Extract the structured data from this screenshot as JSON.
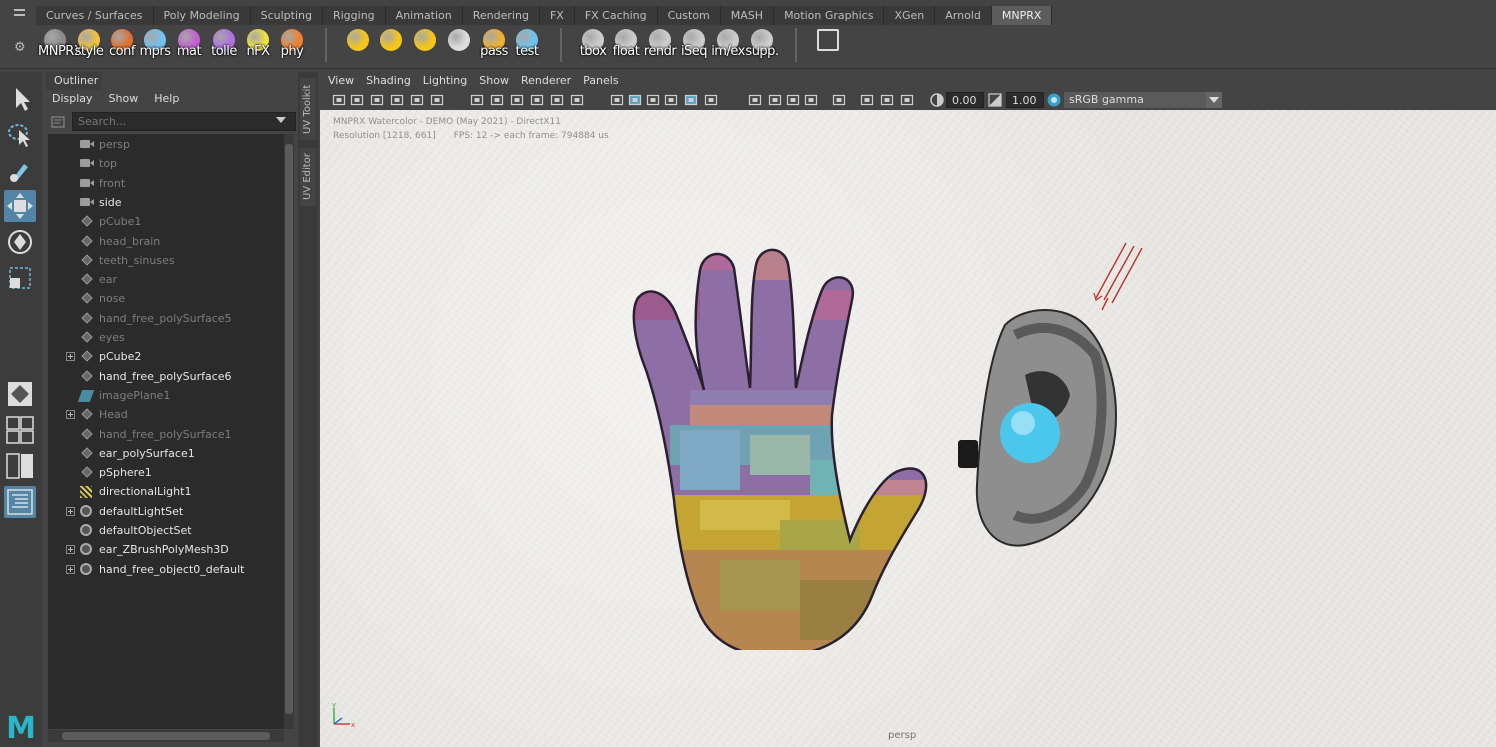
{
  "shelf_tabs": [
    "Curves / Surfaces",
    "Poly Modeling",
    "Sculpting",
    "Rigging",
    "Animation",
    "Rendering",
    "FX",
    "FX Caching",
    "Custom",
    "MASH",
    "Motion Graphics",
    "XGen",
    "Arnold",
    "MNPRX"
  ],
  "active_shelf_tab": "MNPRX",
  "shelf_buttons": [
    {
      "label": "MNPRX",
      "icon": "mnprx-info-icon",
      "color": "#8a8a8a"
    },
    {
      "label": "style",
      "icon": "style-icon",
      "color": "#f0c040"
    },
    {
      "label": "conf",
      "icon": "config-icon",
      "color": "#e07030"
    },
    {
      "label": "mprs",
      "icon": "material-presets-icon",
      "color": "#6fc2ee"
    },
    {
      "label": "mat",
      "icon": "material-icon",
      "color": "#c060d0"
    },
    {
      "label": "tolle",
      "icon": "toolbox-icon",
      "color": "#b070e0"
    },
    {
      "label": "nFX",
      "icon": "noise-fx-icon",
      "color": "#f0e040"
    },
    {
      "label": "phy",
      "icon": "physics-icon",
      "color": "#f08030"
    },
    {
      "label": "",
      "icon": "sun-light-icon",
      "color": "#f5c518"
    },
    {
      "label": "",
      "icon": "light-arrows-icon",
      "color": "#f5c518"
    },
    {
      "label": "",
      "icon": "light-center-icon",
      "color": "#f5c518"
    },
    {
      "label": "",
      "icon": "spot-light-icon",
      "color": "#dddddd"
    },
    {
      "label": "pass",
      "icon": "render-pass-icon",
      "color": "#f0b030"
    },
    {
      "label": "test",
      "icon": "test-scene-icon",
      "color": "#6fc2ee"
    },
    {
      "label": "tbox",
      "icon": "toolbox-window-icon",
      "color": "#cccccc"
    },
    {
      "label": "float",
      "icon": "float-window-icon",
      "color": "#cccccc"
    },
    {
      "label": "rendr",
      "icon": "render-frame-icon",
      "color": "#cccccc"
    },
    {
      "label": "iSeq",
      "icon": "image-sequence-icon",
      "color": "#cccccc"
    },
    {
      "label": "im/ex",
      "icon": "import-export-icon",
      "color": "#cccccc"
    },
    {
      "label": "supp.",
      "icon": "support-icon",
      "color": "#cccccc"
    },
    {
      "label": "",
      "icon": "external-link-icon",
      "color": "#dddddd"
    }
  ],
  "outliner": {
    "tab": "Outliner",
    "menus": [
      "Display",
      "Show",
      "Help"
    ],
    "search_placeholder": "Search...",
    "items": [
      {
        "name": "persp",
        "icon": "camera",
        "dim": true,
        "expand": false
      },
      {
        "name": "top",
        "icon": "camera",
        "dim": true,
        "expand": false
      },
      {
        "name": "front",
        "icon": "camera",
        "dim": true,
        "expand": false
      },
      {
        "name": "side",
        "icon": "camera",
        "dim": false,
        "expand": false
      },
      {
        "name": "pCube1",
        "icon": "mesh",
        "dim": true,
        "expand": false
      },
      {
        "name": "head_brain",
        "icon": "mesh",
        "dim": true,
        "expand": false
      },
      {
        "name": "teeth_sinuses",
        "icon": "mesh",
        "dim": true,
        "expand": false
      },
      {
        "name": "ear",
        "icon": "mesh",
        "dim": true,
        "expand": false
      },
      {
        "name": "nose",
        "icon": "mesh",
        "dim": true,
        "expand": false
      },
      {
        "name": "hand_free_polySurface5",
        "icon": "mesh",
        "dim": true,
        "expand": false
      },
      {
        "name": "eyes",
        "icon": "mesh",
        "dim": true,
        "expand": false
      },
      {
        "name": "pCube2",
        "icon": "mesh",
        "dim": false,
        "expand": true
      },
      {
        "name": "hand_free_polySurface6",
        "icon": "mesh",
        "dim": false,
        "expand": false
      },
      {
        "name": "imagePlane1",
        "icon": "plane",
        "dim": true,
        "expand": false
      },
      {
        "name": "Head",
        "icon": "mesh",
        "dim": true,
        "expand": true
      },
      {
        "name": "hand_free_polySurface1",
        "icon": "mesh",
        "dim": true,
        "expand": false
      },
      {
        "name": "ear_polySurface1",
        "icon": "mesh",
        "dim": false,
        "expand": false
      },
      {
        "name": "pSphere1",
        "icon": "mesh",
        "dim": false,
        "expand": false
      },
      {
        "name": "directionalLight1",
        "icon": "light",
        "dim": false,
        "expand": false
      },
      {
        "name": "defaultLightSet",
        "icon": "set",
        "dim": false,
        "expand": true
      },
      {
        "name": "defaultObjectSet",
        "icon": "set",
        "dim": false,
        "expand": false
      },
      {
        "name": "ear_ZBrushPolyMesh3D",
        "icon": "set",
        "dim": false,
        "expand": true
      },
      {
        "name": "hand_free_object0_default",
        "icon": "set",
        "dim": false,
        "expand": true
      }
    ]
  },
  "side_tabs": [
    "UV Toolkit",
    "UV Editor"
  ],
  "viewport": {
    "menus": [
      "View",
      "Shading",
      "Lighting",
      "Show",
      "Renderer",
      "Panels"
    ],
    "exposure": "0.00",
    "gamma": "1.00",
    "color_space": "sRGB gamma",
    "hud_title": "MNPRX Watercolor - DEMO (May 2021) - DirectX11",
    "hud_resolution": "Resolution [1218, 661]",
    "hud_fps": "FPS: 12 -> each frame: 794884 us",
    "camera": "persp"
  },
  "colors": {
    "accent": "#5285a6",
    "panel": "#444444",
    "list_bg": "#2b2b2b",
    "maya_logo": "#29b6c9"
  }
}
